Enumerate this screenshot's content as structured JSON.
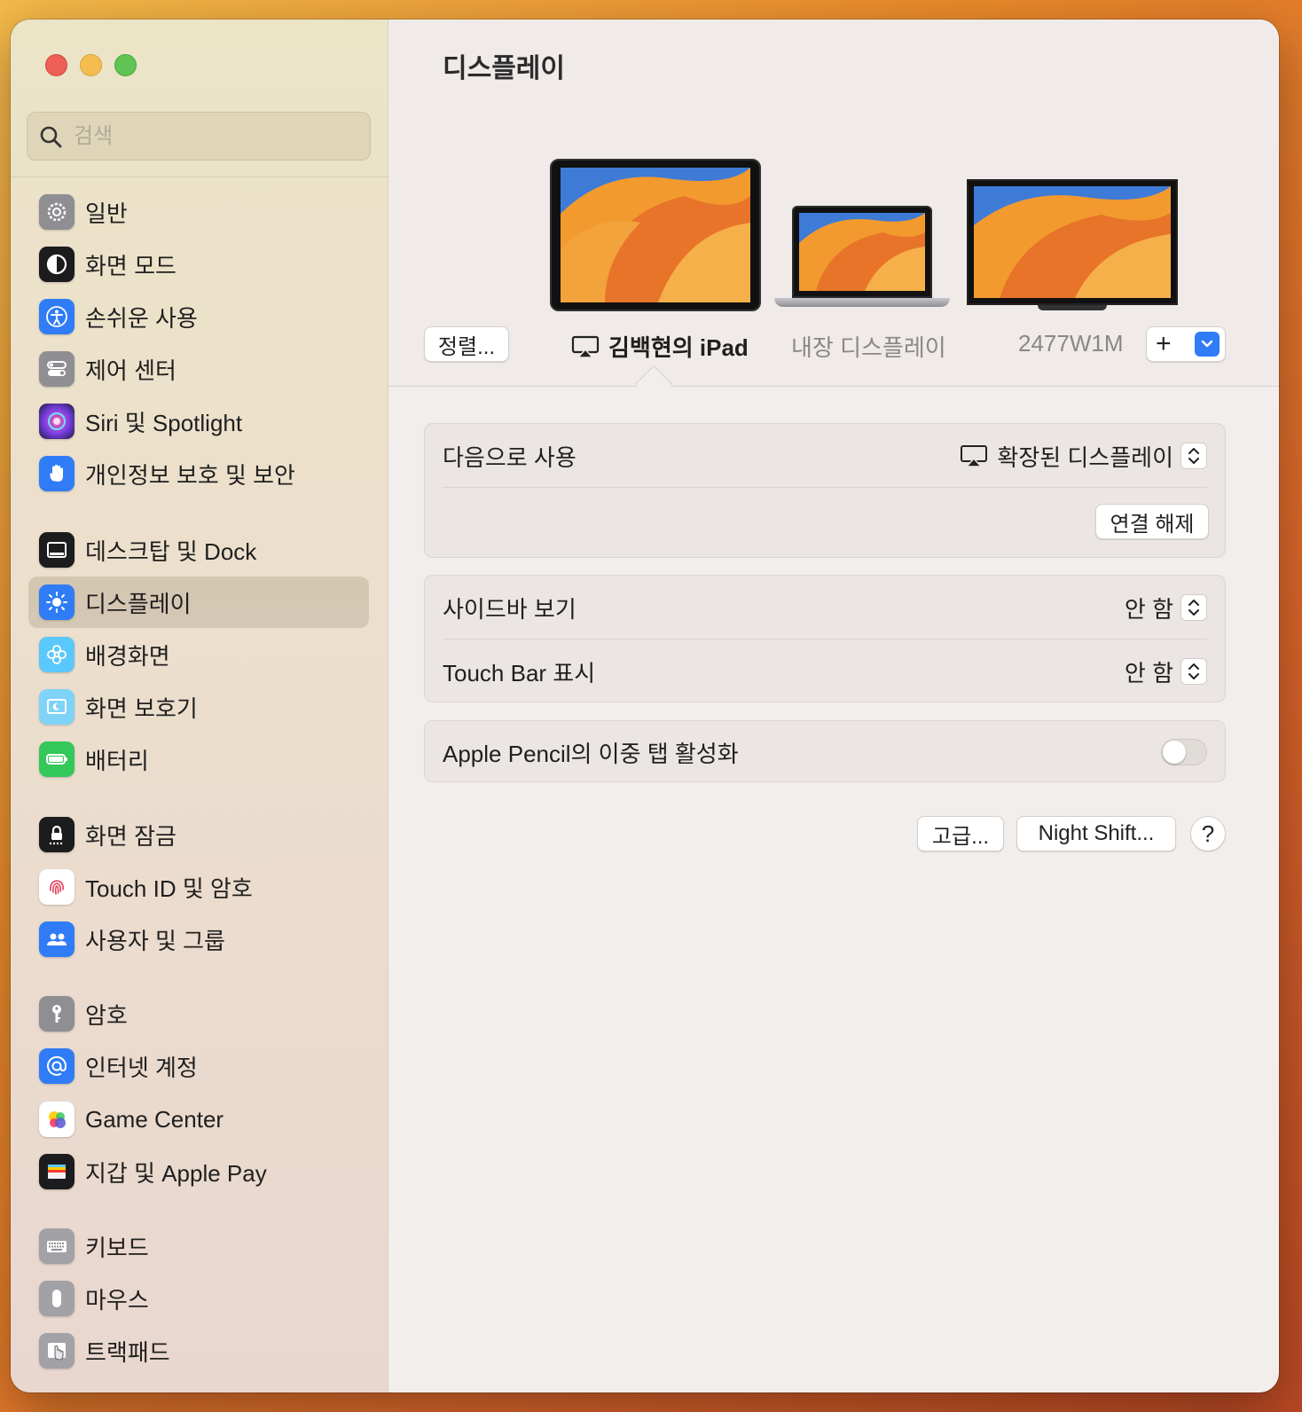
{
  "sidebar": {
    "search_placeholder": "검색",
    "items": [
      {
        "label": "일반",
        "icon": "gear-icon",
        "color": "#8e8e93"
      },
      {
        "label": "화면 모드",
        "icon": "appearance-icon",
        "color": "#1c1c1e"
      },
      {
        "label": "손쉬운 사용",
        "icon": "accessibility-icon",
        "color": "#2f7cf6"
      },
      {
        "label": "제어 센터",
        "icon": "control-center-icon",
        "color": "#8e8e93"
      },
      {
        "label": "Siri 및 Spotlight",
        "icon": "siri-icon",
        "color": "#6a3fb5"
      },
      {
        "label": "개인정보 보호 및 보안",
        "icon": "hand-icon",
        "color": "#2f7cf6"
      },
      {
        "label": "데스크탑 및 Dock",
        "icon": "dock-icon",
        "color": "#1c1c1e"
      },
      {
        "label": "디스플레이",
        "icon": "sun-icon",
        "color": "#2f7cf6",
        "selected": true
      },
      {
        "label": "배경화면",
        "icon": "flower-icon",
        "color": "#5ac8fa"
      },
      {
        "label": "화면 보호기",
        "icon": "screensaver-icon",
        "color": "#5ac8fa"
      },
      {
        "label": "배터리",
        "icon": "battery-icon",
        "color": "#34c759"
      },
      {
        "label": "화면 잠금",
        "icon": "lock-icon",
        "color": "#1c1c1e"
      },
      {
        "label": "Touch ID 및 암호",
        "icon": "fingerprint-icon",
        "color": "#ffffff"
      },
      {
        "label": "사용자 및 그룹",
        "icon": "users-icon",
        "color": "#2f7cf6"
      },
      {
        "label": "암호",
        "icon": "key-icon",
        "color": "#8e8e93"
      },
      {
        "label": "인터넷 계정",
        "icon": "at-icon",
        "color": "#2f7cf6"
      },
      {
        "label": "Game Center",
        "icon": "game-center-icon",
        "color": "#ffffff"
      },
      {
        "label": "지갑 및 Apple Pay",
        "icon": "wallet-icon",
        "color": "#1c1c1e"
      },
      {
        "label": "키보드",
        "icon": "keyboard-icon",
        "color": "#8e8e93"
      },
      {
        "label": "마우스",
        "icon": "mouse-icon",
        "color": "#8e8e93"
      },
      {
        "label": "트랙패드",
        "icon": "trackpad-icon",
        "color": "#8e8e93"
      }
    ]
  },
  "main": {
    "title": "디스플레이",
    "arrange_button": "정렬...",
    "devices": [
      {
        "label": "김백현의 iPad",
        "active": true,
        "icon": "airplay-icon"
      },
      {
        "label": "내장 디스플레이",
        "active": false
      },
      {
        "label": "2477W1M",
        "active": false
      }
    ],
    "add_button": "+",
    "use_as": {
      "label": "다음으로 사용",
      "value": "확장된 디스플레이",
      "icon": "airplay-icon"
    },
    "disconnect_button": "연결 해제",
    "sidebar_view": {
      "label": "사이드바 보기",
      "value": "안 함"
    },
    "touch_bar": {
      "label": "Touch Bar 표시",
      "value": "안 함"
    },
    "pencil": {
      "label": "Apple Pencil의 이중 탭 활성화",
      "enabled": false
    },
    "advanced_button": "고급...",
    "night_shift_button": "Night Shift...",
    "help_button": "?"
  },
  "colors": {
    "accent": "#2f7cf6",
    "wallpaper_orange": "#f08a24"
  }
}
